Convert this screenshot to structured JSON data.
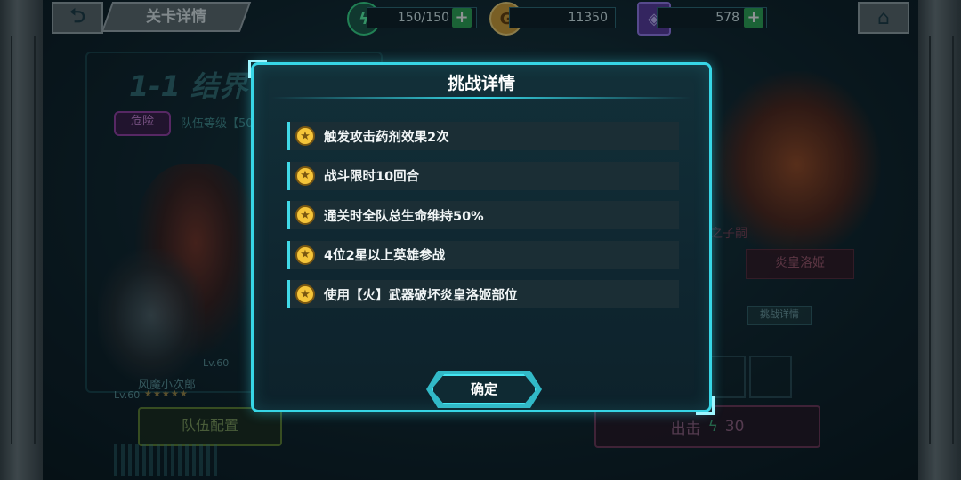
{
  "header": {
    "title": "关卡详情",
    "energy": "150/150",
    "gold": "11350",
    "gems": "578"
  },
  "background": {
    "level_title": "1-1  结界",
    "danger_tag": "危险",
    "team_level": "队伍等级【50",
    "hero_name": "风魔小次郎",
    "hero_lv": "Lv.60",
    "hero_lv_2": "Lv.60",
    "hero_stars": "★★★★★",
    "team_button": "队伍配置",
    "boss_subtitle": "之子嗣",
    "boss_name": "炎皇洛姬",
    "detail_button": "挑战详情",
    "attack_button": "出击",
    "attack_cost": "30"
  },
  "dialog": {
    "title": "挑战详情",
    "conditions": [
      "触发攻击药剂效果2次",
      "战斗限时10回合",
      "通关时全队总生命维持50%",
      "4位2星以上英雄参战",
      "使用【火】武器破坏炎皇洛姬部位"
    ],
    "confirm": "确定"
  },
  "icons": {
    "energy": "lightning-icon",
    "gold": "gold-coin-icon",
    "gem": "gem-cube-icon",
    "star": "star-icon"
  },
  "colors": {
    "accent": "#37d6e6",
    "plus_green": "#2faa55",
    "star_gold": "#f5c53a"
  }
}
